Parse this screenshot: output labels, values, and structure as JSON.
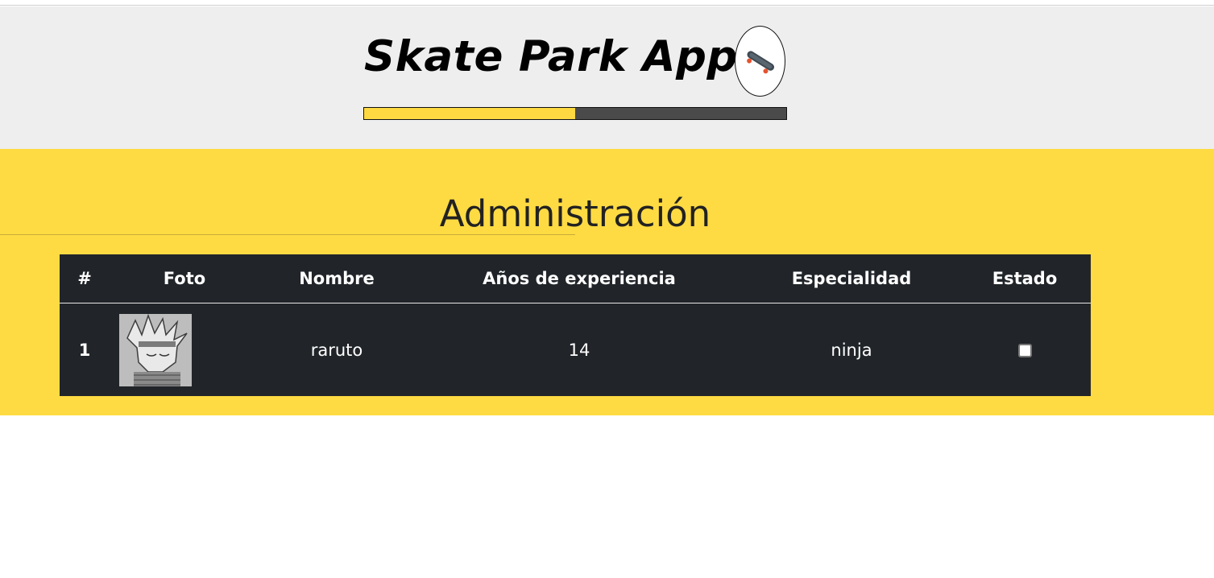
{
  "header": {
    "brand_title": "Skate Park App",
    "logo_icon": "skateboard-icon",
    "progress_fraction": 0.5,
    "progress_fill_color": "#ffd942",
    "progress_track_color": "#4a4a4a"
  },
  "admin": {
    "title": "Administración",
    "background_color": "#ffdb43"
  },
  "table": {
    "headers": [
      "#",
      "Foto",
      "Nombre",
      "Años de experiencia",
      "Especialidad",
      "Estado"
    ],
    "rows": [
      {
        "index": "1",
        "photo_icon": "skater-photo",
        "nombre": "raruto",
        "anios": "14",
        "especialidad": "ninja",
        "estado_checked": false
      }
    ]
  }
}
